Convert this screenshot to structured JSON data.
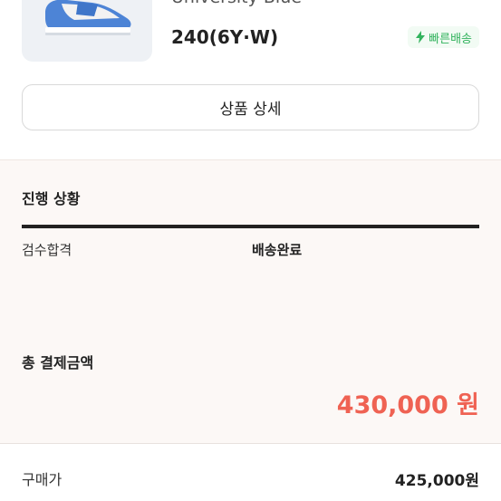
{
  "product": {
    "name": "University Blue",
    "size": "240(6Y·W)",
    "badge": "빠른배송"
  },
  "detail_button": "상품 상세",
  "progress": {
    "title": "진행 상황",
    "steps": [
      "검수합격",
      "배송완료"
    ]
  },
  "payment": {
    "title": "총 결제금액",
    "total": "430,000 원"
  },
  "price": {
    "label": "구매가",
    "value": "425,000원"
  },
  "colors": {
    "accent_red": "#ef6253",
    "badge_green": "#33b35e"
  }
}
